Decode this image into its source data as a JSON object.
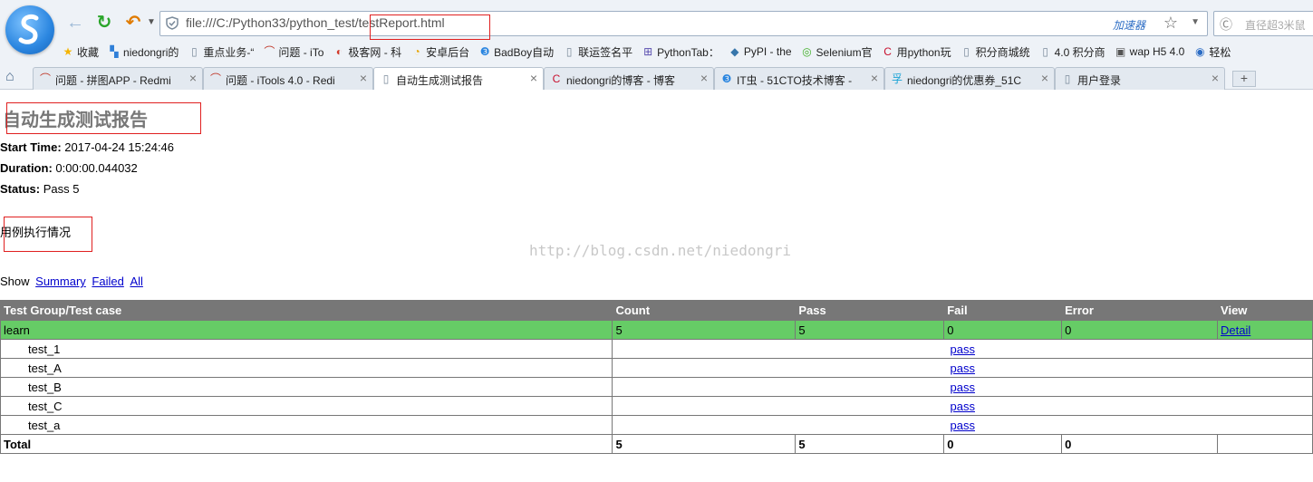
{
  "browser": {
    "url": "file:///C:/Python33/python_test/testReport.html",
    "accelerator": "加速器",
    "search_placeholder": "直径超3米鼠",
    "bookmarks": [
      {
        "label": "收藏",
        "icon": "star-icon"
      },
      {
        "label": "niedongri的",
        "icon": "windows-icon"
      },
      {
        "label": "重点业务-“",
        "icon": "page-icon"
      },
      {
        "label": "问题 - iTo",
        "icon": "redmine-icon"
      },
      {
        "label": "极客网 - 科",
        "icon": "geek-icon"
      },
      {
        "label": "安卓后台",
        "icon": "android-icon"
      },
      {
        "label": "BadBoy自动",
        "icon": "badboy-icon"
      },
      {
        "label": "联运签名平",
        "icon": "page-icon"
      },
      {
        "label": "PythonTab：",
        "icon": "pythontab-icon"
      },
      {
        "label": "PyPI - the",
        "icon": "python-icon"
      },
      {
        "label": "Selenium官",
        "icon": "selenium-icon"
      },
      {
        "label": "用python玩",
        "icon": "csdn-icon"
      },
      {
        "label": "积分商城统",
        "icon": "page-icon"
      },
      {
        "label": "4.0 积分商",
        "icon": "page-icon"
      },
      {
        "label": "wap H5 4.0",
        "icon": "monitor-icon"
      },
      {
        "label": "轻松",
        "icon": "compass-icon"
      }
    ],
    "tabs": [
      {
        "label": "问题 - 拼图APP - Redmi",
        "icon": "redmine-icon",
        "active": false
      },
      {
        "label": "问题 - iTools 4.0 - Redi",
        "icon": "redmine-icon",
        "active": false
      },
      {
        "label": "自动生成测试报告",
        "icon": "page-icon",
        "active": true
      },
      {
        "label": "niedongri的博客 - 博客",
        "icon": "csdn-icon",
        "active": false
      },
      {
        "label": "IT虫 - 51CTO技术博客 -",
        "icon": "cto-icon",
        "active": false
      },
      {
        "label": "niedongri的优惠券_51C",
        "icon": "coupon-icon",
        "active": false
      },
      {
        "label": "用户登录",
        "icon": "page-icon",
        "active": false
      }
    ]
  },
  "report": {
    "title": "自动生成测试报告",
    "start_time_label": "Start Time:",
    "start_time": "2017-04-24 15:24:46",
    "duration_label": "Duration:",
    "duration": "0:00:00.044032",
    "status_label": "Status:",
    "status": "Pass 5",
    "description": "用例执行情况",
    "watermark": "http://blog.csdn.net/niedongri",
    "show_label": "Show",
    "filters": [
      "Summary",
      "Failed",
      "All"
    ],
    "headers": [
      "Test Group/Test case",
      "Count",
      "Pass",
      "Fail",
      "Error",
      "View"
    ],
    "group": {
      "name": "learn",
      "count": "5",
      "pass": "5",
      "fail": "0",
      "error": "0",
      "view": "Detail"
    },
    "cases": [
      {
        "name": "test_1",
        "result": "pass"
      },
      {
        "name": "test_A",
        "result": "pass"
      },
      {
        "name": "test_B",
        "result": "pass"
      },
      {
        "name": "test_C",
        "result": "pass"
      },
      {
        "name": "test_a",
        "result": "pass"
      }
    ],
    "total": {
      "label": "Total",
      "count": "5",
      "pass": "5",
      "fail": "0",
      "error": "0"
    }
  },
  "colors": {
    "group_row": "#66cc66",
    "header_row": "#777777",
    "highlight_box": "#e02020"
  }
}
